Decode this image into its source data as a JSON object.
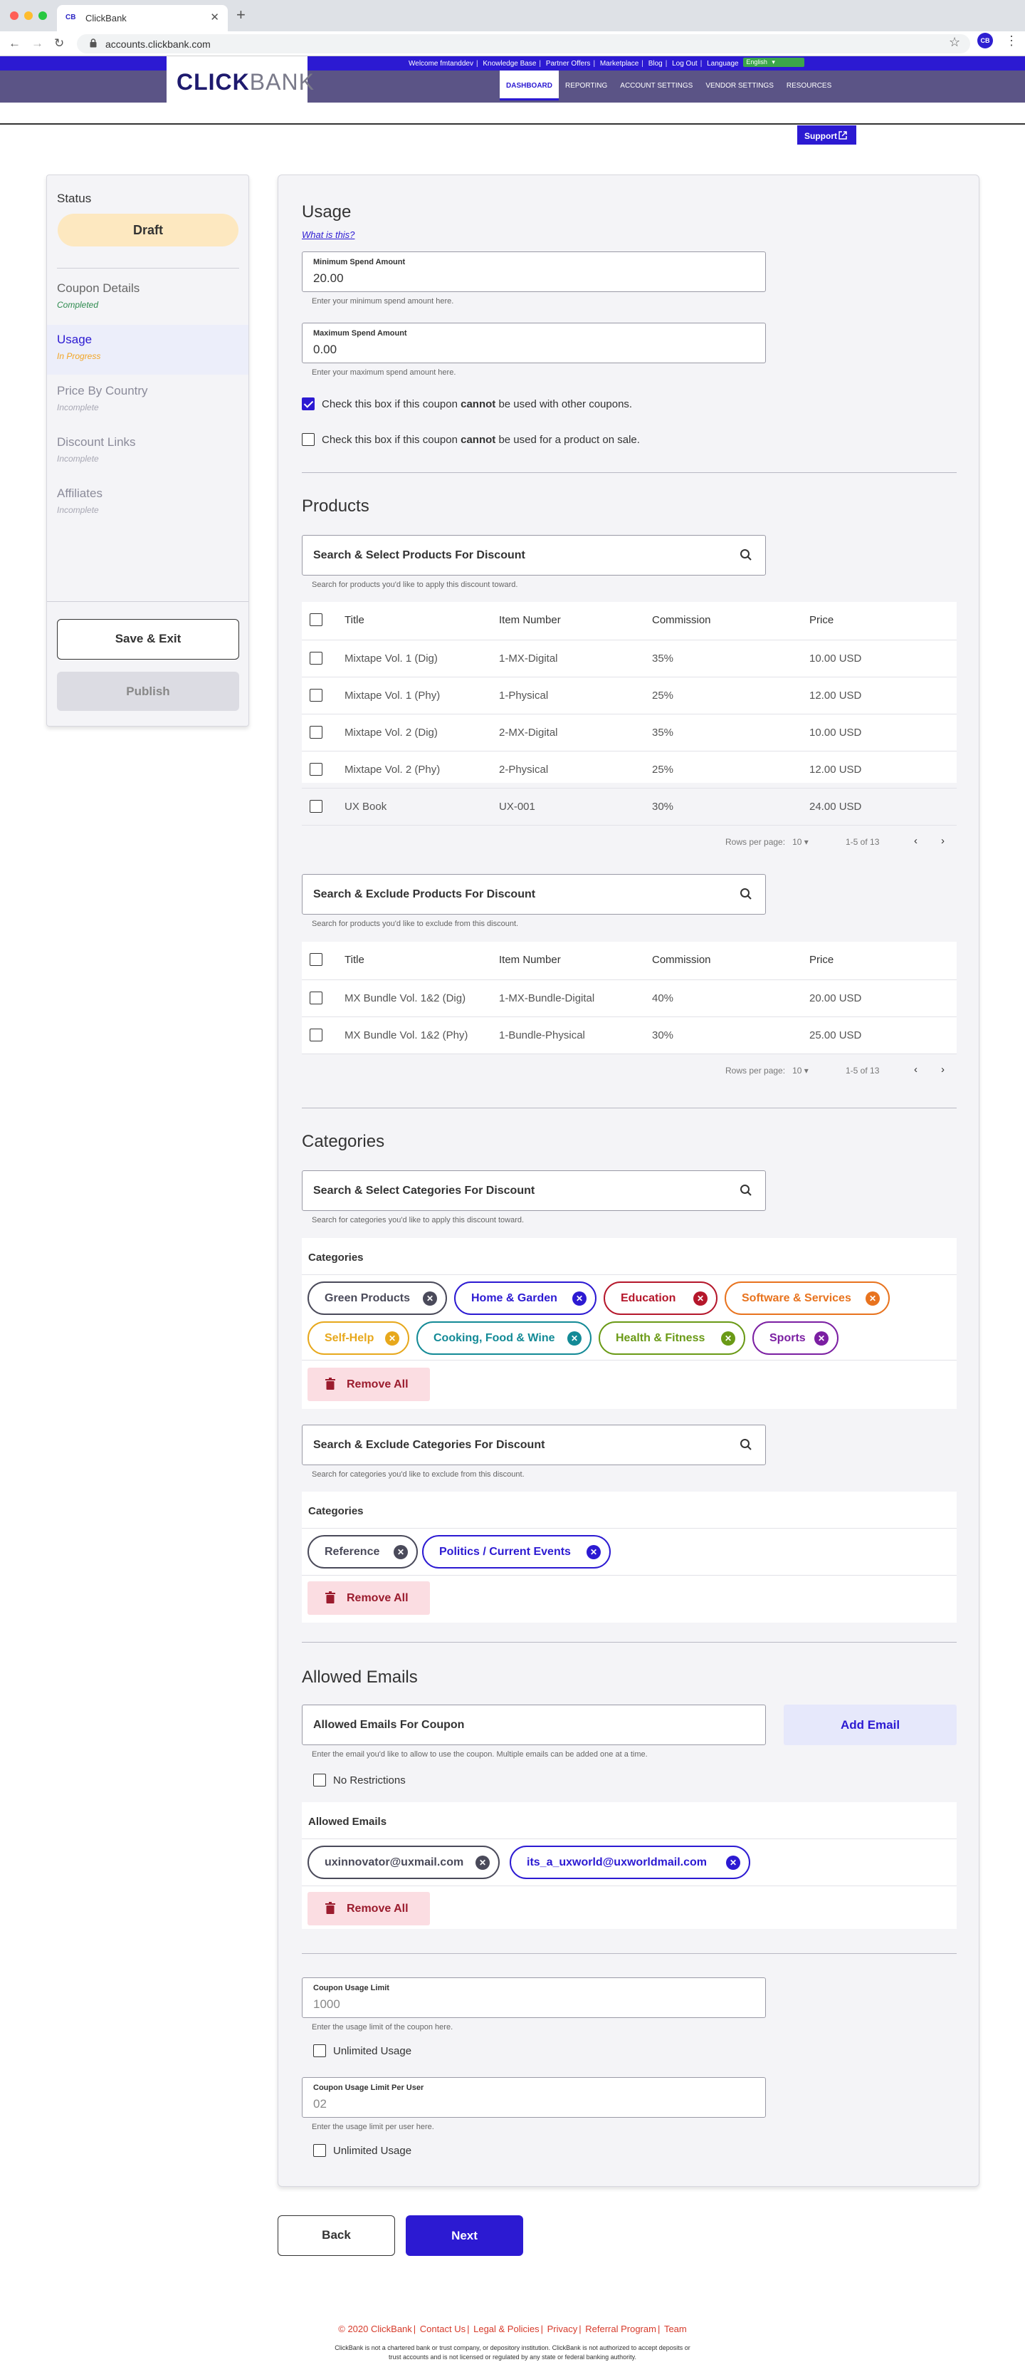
{
  "browser": {
    "tab_title": "ClickBank",
    "tab_favicon": "CB",
    "url": "accounts.clickbank.com",
    "profile_initials": "CB"
  },
  "header": {
    "top_links": [
      "Welcome fmtanddev",
      "Knowledge Base",
      "Partner Offers",
      "Marketplace",
      "Blog",
      "Log Out",
      "Language"
    ],
    "language": "English",
    "logo_click": "CLICK",
    "logo_bank": "BANK",
    "nav": [
      "DASHBOARD",
      "REPORTING",
      "ACCOUNT SETTINGS",
      "VENDOR SETTINGS",
      "RESOURCES"
    ],
    "support": "Support"
  },
  "sidebar": {
    "status_label": "Status",
    "status_value": "Draft",
    "steps": [
      {
        "name": "Coupon Details",
        "state": "Completed"
      },
      {
        "name": "Usage",
        "state": "In Progress"
      },
      {
        "name": "Price By Country",
        "state": "Incomplete"
      },
      {
        "name": "Discount Links",
        "state": "Incomplete"
      },
      {
        "name": "Affiliates",
        "state": "Incomplete"
      }
    ],
    "save_exit": "Save & Exit",
    "publish": "Publish"
  },
  "usage": {
    "title": "Usage",
    "what_link": "What is this?",
    "min_label": "Minimum Spend Amount",
    "min_value": "20.00",
    "min_helper": "Enter your minimum spend amount here.",
    "max_label": "Maximum Spend Amount",
    "max_value": "0.00",
    "max_helper": "Enter your maximum spend amount here.",
    "check1_pre": "Check this box if this coupon ",
    "check1_bold": "cannot",
    "check1_post": " be used with other coupons.",
    "check2_pre": "Check this box if this coupon ",
    "check2_bold": "cannot",
    "check2_post": " be used for a product on sale."
  },
  "products": {
    "title": "Products",
    "select_placeholder": "Search & Select Products For Discount",
    "select_helper": "Search for products you'd like to apply this discount toward.",
    "headers": [
      "Title",
      "Item Number",
      "Commission",
      "Price"
    ],
    "rows": [
      [
        "Mixtape Vol. 1 (Dig)",
        "1-MX-Digital",
        "35%",
        "10.00 USD"
      ],
      [
        "Mixtape Vol. 1 (Phy)",
        "1-Physical",
        "25%",
        "12.00 USD"
      ],
      [
        "Mixtape Vol. 2 (Dig)",
        "2-MX-Digital",
        "35%",
        "10.00 USD"
      ],
      [
        "Mixtape Vol. 2 (Phy)",
        "2-Physical",
        "25%",
        "12.00 USD"
      ],
      [
        "UX Book",
        "UX-001",
        "30%",
        "24.00 USD"
      ]
    ],
    "rows_per_page_label": "Rows per page:",
    "rows_per_page": "10",
    "range": "1-5 of 13",
    "exclude_placeholder": "Search & Exclude Products For Discount",
    "exclude_helper": "Search for products you'd like to exclude from this discount.",
    "exclude_rows": [
      [
        "MX Bundle Vol. 1&2 (Dig)",
        "1-MX-Bundle-Digital",
        "40%",
        "20.00 USD"
      ],
      [
        "MX Bundle Vol. 1&2 (Phy)",
        "1-Bundle-Physical",
        "30%",
        "25.00 USD"
      ]
    ],
    "exclude_range": "1-5 of 13"
  },
  "categories": {
    "title": "Categories",
    "select_placeholder": "Search & Select Categories For Discount",
    "select_helper": "Search for categories you'd like to apply this discount toward.",
    "sub_header": "Categories",
    "chips": [
      {
        "label": "Green Products",
        "color": "#4a4a5a"
      },
      {
        "label": "Home & Garden",
        "color": "#2c1ad2"
      },
      {
        "label": "Education",
        "color": "#b5172b"
      },
      {
        "label": "Software & Services",
        "color": "#e8731e"
      },
      {
        "label": "Self-Help",
        "color": "#e7a81c"
      },
      {
        "label": "Cooking, Food & Wine",
        "color": "#138a96"
      },
      {
        "label": "Health & Fitness",
        "color": "#6a9a16"
      },
      {
        "label": "Sports",
        "color": "#7b1fa2"
      }
    ],
    "remove_all": "Remove All",
    "exclude_placeholder": "Search & Exclude Categories For Discount",
    "exclude_helper": "Search for categories you'd like to exclude from this discount.",
    "exclude_chips": [
      {
        "label": "Reference",
        "color": "#4a4a5a"
      },
      {
        "label": "Politics / Current Events",
        "color": "#2c1ad2"
      }
    ]
  },
  "emails": {
    "title": "Allowed Emails",
    "input_placeholder": "Allowed Emails For Coupon",
    "add_button": "Add Email",
    "helper": "Enter the email you'd like to allow to use the coupon. Multiple emails can be added one at a time.",
    "no_restrictions": "No Restrictions",
    "sub_header": "Allowed Emails",
    "chips": [
      {
        "label": "uxinnovator@uxmail.com",
        "color": "#4a4a5a"
      },
      {
        "label": "its_a_uxworld@uxworldmail.com",
        "color": "#2c1ad2"
      }
    ],
    "remove_all": "Remove All"
  },
  "limits": {
    "usage_label": "Coupon Usage Limit",
    "usage_value": "1000",
    "usage_helper": "Enter the usage limit of the coupon here.",
    "unlimited": "Unlimited Usage",
    "per_user_label": "Coupon Usage Limit Per User",
    "per_user_value": "02",
    "per_user_helper": "Enter the usage limit per user here.",
    "unlimited2": "Unlimited Usage"
  },
  "actions": {
    "back": "Back",
    "next": "Next"
  },
  "footer": {
    "links": [
      "© 2020 ClickBank",
      "Contact Us",
      "Legal & Policies",
      "Privacy",
      "Referral Program",
      "Team"
    ],
    "disclaimer": "ClickBank is not a chartered bank or trust company, or depository institution. ClickBank is not authorized to accept deposits or trust accounts and is not licensed or regulated by any state or federal banking authority."
  }
}
